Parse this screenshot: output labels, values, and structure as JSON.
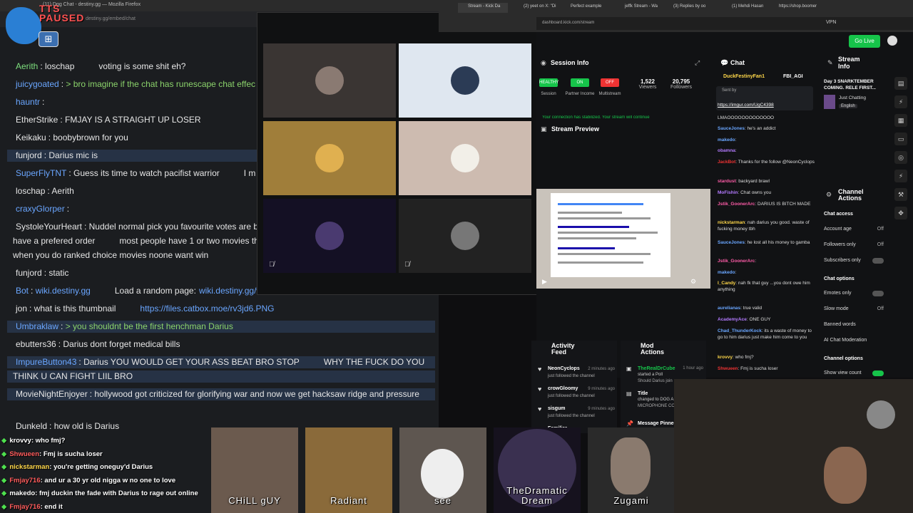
{
  "left_window": {
    "title": "(11) Dgg Chat - destiny.gg — Mozilla Firefox",
    "address": "destiny.gg/embed/chat",
    "tts_status": "TTS\nPAUSED",
    "grid_icon": "grid-icon"
  },
  "chat": [
    {
      "user": "Aerith",
      "text": "loschap",
      "tail": "voting is some shit eh?",
      "color": "#7ee07e"
    },
    {
      "user": "juicygoated",
      "text": "> bro imagine if the chat has runescape chat effec",
      "color": "#6aa6ff",
      "greentext": true
    },
    {
      "user": "hauntr",
      "text": "",
      "color": "#6aa6ff"
    },
    {
      "user": "EtherStrike",
      "text": "FMJAY IS A STRAIGHT UP LOSER",
      "color": "#e6e6e6"
    },
    {
      "user": "Keikaku",
      "text": "boobybrown for you",
      "color": "#e6e6e6"
    },
    {
      "user": "funjord",
      "text": "Darius mic is",
      "color": "#e6e6e6"
    },
    {
      "user": "SuperFlyTNT",
      "text": "Guess its time to watch pacifist warrior",
      "tail": "I m",
      "color": "#6aa6ff"
    },
    {
      "user": "loschap",
      "text": "Aerith",
      "color": "#e6e6e6"
    },
    {
      "user": "craxyGlorper",
      "text": "",
      "color": "#6aa6ff"
    },
    {
      "user": "SystoleYourHeart",
      "text": "Nuddel normal pick you favourite votes are b",
      "line2": "have a prefered order",
      "line2b": "most people have 1 or two movies th",
      "line3": "when you do ranked choice movies noone want win",
      "color": "#e6e6e6"
    },
    {
      "user": "funjord",
      "text": "static",
      "color": "#e6e6e6"
    },
    {
      "user": "Bot",
      "text": "wiki.destiny.gg",
      "tail": "Load a random page:",
      "link2": "wiki.destiny.gg/wi",
      "color": "#6aa6ff"
    },
    {
      "user": "jon",
      "text": "what is this thumbnail",
      "link": "https://files.catbox.moe/rv3jd6.PNG",
      "color": "#e6e6e6"
    },
    {
      "user": "Umbraklaw",
      "text": "> you shouldnt be the first henchman Darius",
      "color": "#6aa6ff",
      "greentext": true
    },
    {
      "user": "ebutters36",
      "text": "Darius dont forget medical bills",
      "color": "#e6e6e6"
    },
    {
      "user": "ImpureButton43",
      "text": "Darius YOU WOULD GET YOUR ASS BEAT BRO STOP",
      "tail": "WHY THE FUCK DO YOU",
      "line2": "THINK U CAN FIGHT LIIL BRO",
      "color": "#6aa6ff"
    },
    {
      "user": "MovieNightEnjoyer",
      "text": "hollywood got criticized for glorifying war and now we get hacksaw ridge and pressure",
      "color": "#e6e6e6"
    },
    {
      "user": "Dunkeld",
      "text": "how old is Darius",
      "color": "#e6e6e6"
    }
  ],
  "overlay_chat": [
    {
      "user": "krovvy",
      "text": ": who fmj?",
      "color": "#ffffff"
    },
    {
      "user": "Shwueen",
      "text": ": Fmj is sucha loser",
      "color": "#ff5c5c"
    },
    {
      "user": "nickstarman",
      "text": ": you're getting oneguy'd Darius",
      "color": "#ffd84a"
    },
    {
      "user": "Fmjay716",
      "text": ": and ur a 30 yr old nigga w no one to love",
      "color": "#ff5c5c"
    },
    {
      "user": "makedo",
      "text": ": fmj duckin the fade with Darius to rage out online",
      "color": "#ffffff"
    },
    {
      "user": "Fmjay716",
      "text": ": end it",
      "color": "#ff5c5c"
    }
  ],
  "browser": {
    "tabs": [
      "Stream - Kick Da",
      "(2) yeet on X: \"Di",
      "Perfect example",
      "jeffk Stream - Wa",
      "(3) Replies by oo",
      "(1) Mehdi Hasan",
      "https://shop.boomer"
    ],
    "address": "dashboard.kick.com/stream",
    "vpn": "VPN",
    "go_live": "Go Live"
  },
  "session": {
    "title": "Session Info",
    "badges": [
      {
        "label": "HEALTHY",
        "sub": "Session",
        "color": "#16c44a"
      },
      {
        "label": "ON",
        "sub": "Partner Income",
        "color": "#16c44a"
      },
      {
        "label": "OFF",
        "sub": "Multistream",
        "color": "#e33"
      }
    ],
    "viewers": "1,522",
    "viewers_label": "Viewers",
    "followers": "20,795",
    "followers_label": "Followers",
    "notice": "Your connection has stabilized. Your stream will continue"
  },
  "preview": {
    "title": "Stream Preview"
  },
  "kick_chat": {
    "title": "Chat",
    "pinned_users": [
      "DuckFestinyFan1",
      "FBI_AGI"
    ],
    "sent_by": "Sent by",
    "pinned_link": "https://imgur.com/UgC4398",
    "messages": [
      {
        "user": "",
        "text": "LMAOOOOOOOOOOOOO",
        "color": "#ddd"
      },
      {
        "user": "SauceJones",
        "text": "he's an addict",
        "color": "#6aa6ff"
      },
      {
        "user": "makedo",
        "text": "",
        "color": "#6aa6ff"
      },
      {
        "user": "obamna",
        "text": "",
        "color": "#b37aff"
      },
      {
        "user": "JackBot",
        "text": "Thanks for the follow @NeonCyclops",
        "color": "#e33"
      },
      {
        "user": "stardust",
        "text": "backyard brawl",
        "color": "#ff5ca8"
      },
      {
        "user": "MoFishin",
        "text": "Chat owns you",
        "color": "#b37aff"
      },
      {
        "user": "Jstik_GoonerArc",
        "text": "DARIUS IS BITCH MADE",
        "color": "#ff5ca8"
      },
      {
        "user": "nickstarman",
        "text": "nah darius you good. waste of fucking money tbh",
        "color": "#ffd84a"
      },
      {
        "user": "SauceJones",
        "text": "he lost all his money to gamba",
        "color": "#6aa6ff"
      },
      {
        "user": "Jstik_GoonerArc",
        "text": "",
        "color": "#ff5ca8"
      },
      {
        "user": "makedo",
        "text": "",
        "color": "#6aa6ff"
      },
      {
        "user": "l_Candy",
        "text": "nah fk that guy ...you dont owe him anything",
        "color": "#ffd84a"
      },
      {
        "user": "aurelianas",
        "text": "true valid",
        "color": "#6aa6ff"
      },
      {
        "user": "AcademyAce",
        "text": "ONE GUY",
        "color": "#b37aff"
      },
      {
        "user": "Chad_ThunderKock",
        "text": "its a waste of money to go to him darius just make him come to you",
        "color": "#6aa6ff"
      },
      {
        "user": "krovvy",
        "text": "who fmj?",
        "color": "#ffd84a"
      },
      {
        "user": "Shwueen",
        "text": "Fmj is sucha loser",
        "color": "#e33"
      }
    ]
  },
  "stream_info": {
    "title": "Stream Info",
    "stream_title": "Day 3 SNARKTEMBER COMING. RELE FIRST...",
    "category": "Just Chatting",
    "language": "English"
  },
  "channel_actions": {
    "title": "Channel Actions",
    "chat_access": "Chat access",
    "rows": [
      {
        "label": "Account age",
        "value": "Off"
      },
      {
        "label": "Followers only",
        "value": "Off"
      },
      {
        "label": "Subscribers only",
        "value": ""
      }
    ],
    "chat_options": "Chat options",
    "options": [
      {
        "label": "Emotes only",
        "value": ""
      },
      {
        "label": "Slow mode",
        "value": "Off"
      },
      {
        "label": "Banned words",
        "value": ""
      },
      {
        "label": "AI Chat Moderation",
        "value": ""
      }
    ],
    "channel_options": "Channel options",
    "show_view_count": "Show view count"
  },
  "activity": {
    "title": "Activity Feed",
    "items": [
      {
        "name": "NeonCyclops",
        "time": "2 minutes ago",
        "action": "just followed the channel"
      },
      {
        "name": "crowGloomy",
        "time": "9 minutes ago",
        "action": "just followed the channel"
      },
      {
        "name": "sisgum",
        "time": "9 minutes ago",
        "action": "just followed the channel"
      },
      {
        "name": "Familiar",
        "time": "",
        "action": ""
      }
    ]
  },
  "mod_actions": {
    "title": "Mod Actions",
    "items": [
      {
        "name": "TheRealDrCube",
        "time": "1 hour ago",
        "action": "started a Poll",
        "detail": "Should Darius join"
      },
      {
        "name": "Title",
        "time": "",
        "action": "changed to DOG A...",
        "detail": "MICROPHONE CO... darius!!"
      },
      {
        "name": "Message Pinned",
        "time": "",
        "action": "",
        "detail": ""
      }
    ]
  },
  "webcams": [
    {
      "label": "CHiLL gUY"
    },
    {
      "label": "Radiant"
    },
    {
      "label": "see"
    },
    {
      "label": "TheDramatic Dream"
    },
    {
      "label": "Zugami"
    }
  ],
  "grid_tiles": [
    {
      "bg": "#3a3533"
    },
    {
      "bg": "#dfe7f0"
    },
    {
      "bg": "#a07e3a"
    },
    {
      "bg": "#cdbbb0"
    },
    {
      "bg": "#141024"
    },
    {
      "bg": "#222222"
    }
  ]
}
